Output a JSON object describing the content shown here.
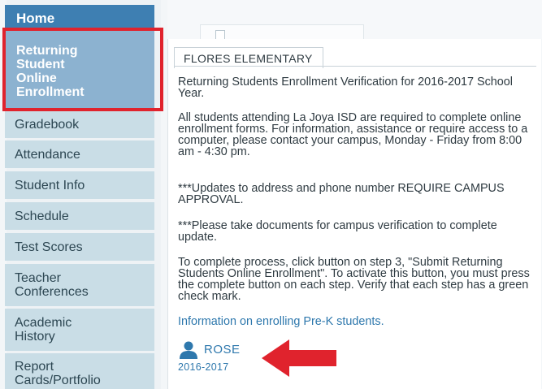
{
  "sidebar": {
    "items": [
      {
        "label": "Home"
      },
      {
        "label": "Returning Student Online Enrollment"
      },
      {
        "label": "Gradebook"
      },
      {
        "label": "Attendance"
      },
      {
        "label": "Student Info"
      },
      {
        "label": "Schedule"
      },
      {
        "label": "Test Scores"
      },
      {
        "label": "Teacher Conferences"
      },
      {
        "label": "Academic History"
      },
      {
        "label": "Report Cards/Portfolio"
      }
    ]
  },
  "main": {
    "school_tab": "FLORES ELEMENTARY",
    "paragraphs": [
      "Returning Students Enrollment Verification for 2016-2017 School Year.",
      "All students attending La Joya ISD are required to complete online enrollment forms. For information, assistance or require access to a computer, please contact your campus, Monday - Friday from 8:00 am - 4:30 pm.",
      "***Updates to address and phone number REQUIRE CAMPUS APPROVAL.",
      "***Please take documents for campus verification to complete update.",
      "To complete process, click button on step 3, \"Submit Returning Students Online Enrollment\". To activate this button, you must press the complete button on each step. Verify that each step has a green check mark."
    ],
    "prek_link": "Information on enrolling Pre-K students.",
    "student": {
      "name": "ROSE",
      "year": "2016-2017"
    }
  },
  "colors": {
    "home_bg": "#3e7fb2",
    "active_item_bg": "#8cb2d0",
    "nav_item_bg": "#c9dde6",
    "link": "#2e78ad",
    "highlight_red": "#e0232d"
  },
  "icons": {
    "student_avatar": "user-icon",
    "annotation_arrow": "red-arrow-left-icon",
    "document": "document-icon"
  }
}
